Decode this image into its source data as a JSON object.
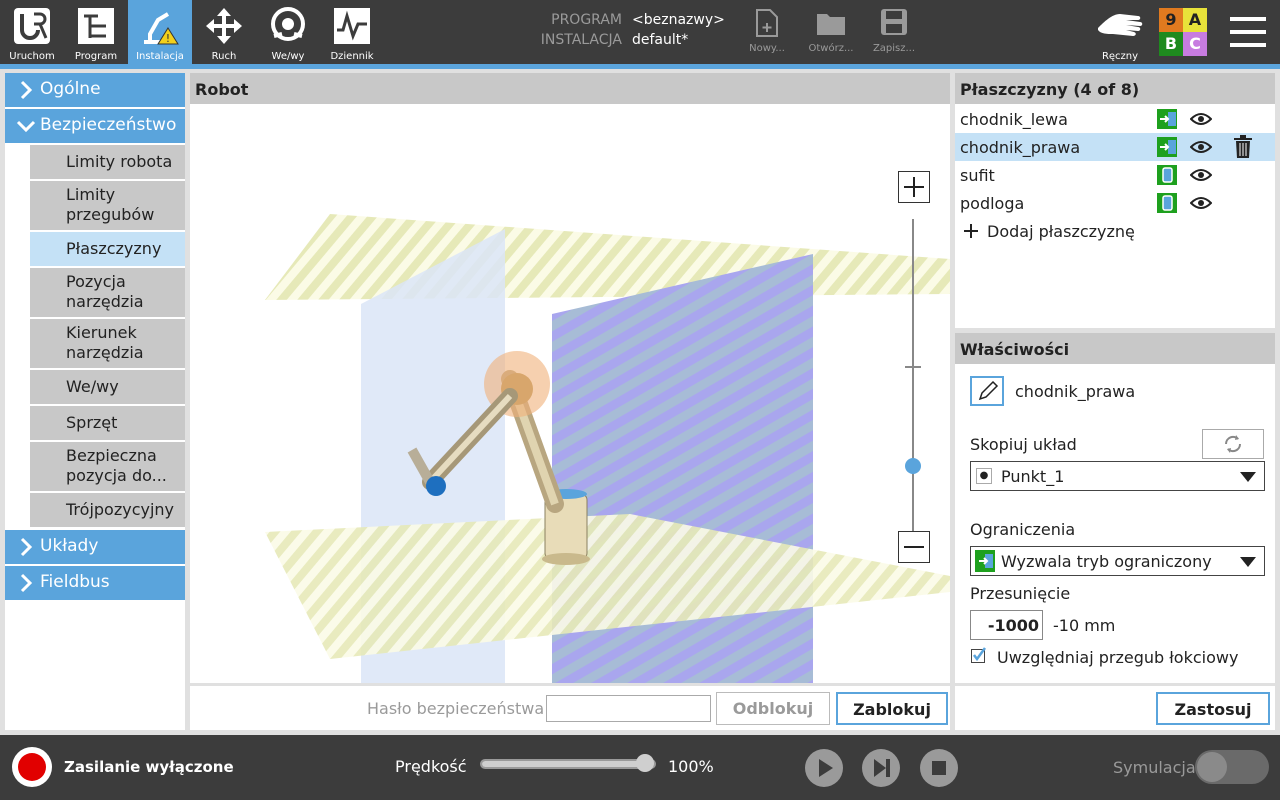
{
  "topbar": {
    "buttons": [
      {
        "label": "Uruchom",
        "icon": "ur-logo-icon"
      },
      {
        "label": "Program",
        "icon": "program-icon"
      },
      {
        "label": "Instalacja",
        "icon": "installation-warning-icon"
      },
      {
        "label": "Ruch",
        "icon": "move-arrows-icon"
      },
      {
        "label": "We/wy",
        "icon": "io-icon"
      },
      {
        "label": "Dziennik",
        "icon": "log-icon"
      }
    ],
    "program_label": "PROGRAM",
    "program_value": "<beznazwy>",
    "installation_label": "INSTALACJA",
    "installation_value": "default*",
    "file_new": "Nowy...",
    "file_open": "Otwórz...",
    "file_save": "Zapisz...",
    "mode_label": "Ręczny",
    "badges": [
      "9",
      "A",
      "B",
      "C"
    ],
    "badge_colors": [
      "#e07a1f",
      "#e8e23a",
      "#1e8a1e",
      "#c77ce0"
    ]
  },
  "sidebar": {
    "sections": [
      {
        "label": "Ogólne",
        "expanded": false
      },
      {
        "label": "Bezpieczeństwo",
        "expanded": true
      },
      {
        "label": "Układy",
        "expanded": false
      },
      {
        "label": "Fieldbus",
        "expanded": false
      }
    ],
    "safety_items": [
      "Limity robota",
      "Limity przegubów",
      "Płaszczyzny",
      "Pozycja narzędzia",
      "Kierunek narzędzia",
      "We/wy",
      "Sprzęt",
      "Bezpieczna pozycja do...",
      "Trójpozycyjny"
    ],
    "selected": "Płaszczyzny"
  },
  "robot_panel": {
    "title": "Robot"
  },
  "password_bar": {
    "label": "Hasło bezpieczeństwa",
    "value": "",
    "unlock": "Odblokuj",
    "lock": "Zablokuj",
    "apply": "Zastosuj"
  },
  "planes": {
    "title": "Płaszczyzny (4 of 8)",
    "rows": [
      {
        "name": "chodnik_lewa",
        "mode": "trigger"
      },
      {
        "name": "chodnik_prawa",
        "mode": "trigger",
        "selected": true
      },
      {
        "name": "sufit",
        "mode": "normal"
      },
      {
        "name": "podloga",
        "mode": "normal"
      }
    ],
    "add_label": "Dodaj płaszczyznę"
  },
  "properties": {
    "title": "Właściwości",
    "name": "chodnik_prawa",
    "copy_label": "Skopiuj układ",
    "copy_value": "Punkt_1",
    "restrictions_label": "Ograniczenia",
    "restrictions_value": "Wyzwala tryb ograniczony",
    "offset_label": "Przesunięcie",
    "offset_value": "-1000",
    "offset_unit": "-10 mm",
    "elbow_label": "Uwzględniaj przegub łokciowy",
    "elbow_checked": true
  },
  "bottom": {
    "power_label": "Zasilanie wyłączone",
    "speed_label": "Prędkość",
    "speed_value": "100%",
    "speed_fraction": 1.0,
    "simulation_label": "Symulacja"
  },
  "colors": {
    "accent": "#5aa4dc",
    "topbar": "#3c3c3c",
    "selected": "#c4e1f6"
  }
}
